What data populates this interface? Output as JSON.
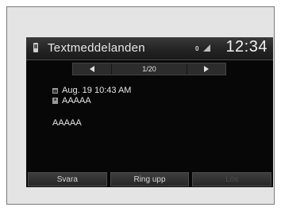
{
  "header": {
    "title": "Textmeddelanden",
    "status_indicator": "0",
    "clock": "12:34",
    "icon_left": "phone-icon",
    "icon_status": "signal-icon"
  },
  "navigation": {
    "prev_icon": "triangle-left-icon",
    "next_icon": "triangle-right-icon",
    "page_counter": "1/20"
  },
  "message": {
    "date": "Aug. 19 10:43 AM",
    "sender": "AAAAA",
    "body": "AAAAA"
  },
  "footer": {
    "buttons": [
      {
        "label": "Svara",
        "enabled": true
      },
      {
        "label": "Ring upp",
        "enabled": true
      },
      {
        "label": "Lös",
        "enabled": false
      }
    ]
  },
  "colors": {
    "screen_bg": "#070707",
    "text": "#e6e6e6",
    "frame_bg": "#e4e4e4"
  }
}
